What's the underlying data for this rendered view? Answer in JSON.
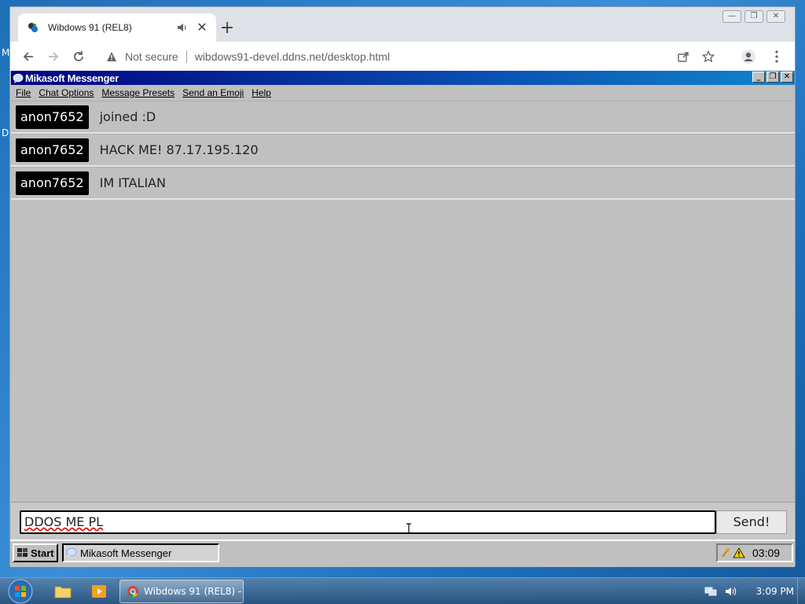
{
  "desktop": {
    "letter_m": "M",
    "letter_d": "D"
  },
  "browser": {
    "tab_title": "Wibdows 91 (REL8)",
    "tab_close": "✕",
    "new_tab": "+",
    "security_label": "Not secure",
    "url": "wibdows91-devel.ddns.net/desktop.html",
    "window_controls": [
      "—",
      "❐",
      "✕"
    ]
  },
  "messenger": {
    "title": "Mikasoft Messenger",
    "controls": [
      "_",
      "❐",
      "✕"
    ],
    "menu": [
      "File",
      "Chat Options",
      "Message Presets",
      "Send an Emoji",
      "Help"
    ],
    "messages": [
      {
        "user": "anon7652",
        "text": "joined :D"
      },
      {
        "user": "anon7652",
        "text": "HACK ME! 87.17.195.120"
      },
      {
        "user": "anon7652",
        "text": "IM ITALIAN"
      }
    ],
    "input_value": "DDOS ME PL",
    "send_label": "Send!"
  },
  "w91_taskbar": {
    "start_label": "Start",
    "task_label": "Mikasoft Messenger",
    "clock": "03:09"
  },
  "win7_taskbar": {
    "task_label": "Wibdows 91 (REL8) - ...",
    "clock": "3:09 PM"
  },
  "colors": {
    "titlebar_start": "#000080",
    "titlebar_end": "#1084d0",
    "w91_gray": "#c0c0c0",
    "username_bg": "#000000"
  }
}
